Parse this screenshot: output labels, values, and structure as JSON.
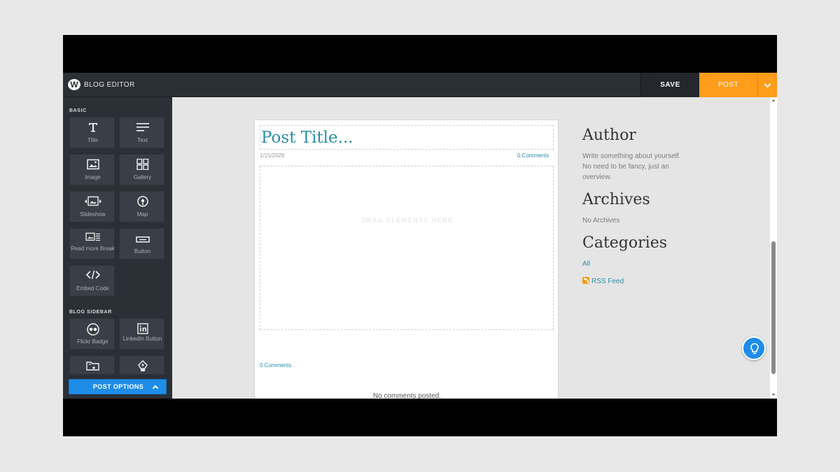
{
  "topbar": {
    "logo_letter": "W",
    "title": "BLOG EDITOR",
    "save_label": "SAVE",
    "post_label": "POST",
    "post_menu_icon": "chevron-down-icon"
  },
  "sidebar": {
    "basic_label": "BASIC",
    "basic_items": [
      {
        "label": "Title",
        "icon": "title-icon"
      },
      {
        "label": "Text",
        "icon": "text-icon"
      },
      {
        "label": "Image",
        "icon": "image-icon"
      },
      {
        "label": "Gallery",
        "icon": "gallery-icon"
      },
      {
        "label": "Slideshow",
        "icon": "slideshow-icon"
      },
      {
        "label": "Map",
        "icon": "map-pin-icon"
      },
      {
        "label": "Read more Break",
        "icon": "read-more-icon"
      },
      {
        "label": "Button",
        "icon": "button-icon"
      },
      {
        "label": "Embed Code",
        "icon": "code-icon"
      }
    ],
    "blog_sidebar_label": "BLOG SIDEBAR",
    "blog_sidebar_items": [
      {
        "label": "Flickr Badge",
        "icon": "flickr-icon"
      },
      {
        "label": "LinkedIn Button",
        "icon": "linkedin-icon"
      },
      {
        "label": "",
        "icon": "folder-icon"
      },
      {
        "label": "",
        "icon": "pen-icon"
      }
    ],
    "post_options_label": "POST OPTIONS"
  },
  "post": {
    "title": "Post Title...",
    "date": "1/15/2026",
    "comments_link": "0 Comments",
    "drop_placeholder": "DRAG ELEMENTS HERE",
    "comments_link_bottom": "0 Comments",
    "no_comments": "No comments posted."
  },
  "blog_sidebar": {
    "author_heading": "Author",
    "author_text": "Write something about yourself. No need to be fancy, just an overview.",
    "archives_heading": "Archives",
    "archives_text": "No Archives",
    "categories_heading": "Categories",
    "categories_all": "All",
    "rss_label": "RSS Feed"
  },
  "colors": {
    "accent_orange": "#ff9c1a",
    "accent_blue": "#1e8de8",
    "link_teal": "#2a8fa6",
    "sidebar_bg": "#2b2f36"
  }
}
